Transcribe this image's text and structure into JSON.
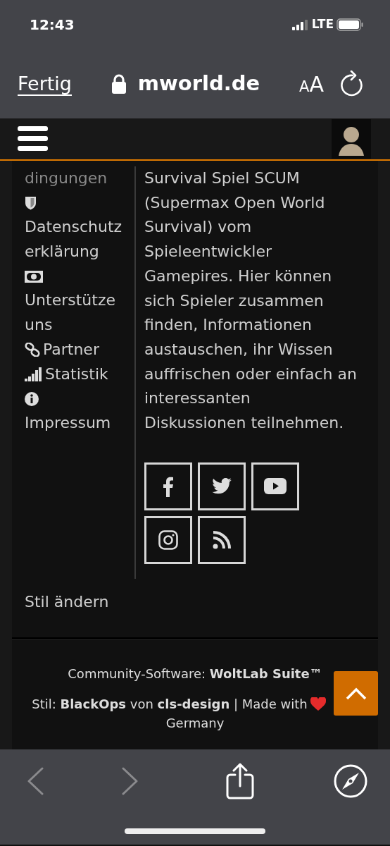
{
  "status_bar": {
    "time": "12:43",
    "network": "LTE"
  },
  "url_bar": {
    "done": "Fertig",
    "address": "mworld.de",
    "text_size": "AA"
  },
  "sidebar": {
    "items": [
      {
        "kind": "plain",
        "lines": [
          "dingungen"
        ]
      },
      {
        "kind": "privacy",
        "lines": [
          "Datenschutz",
          "erklärung"
        ]
      },
      {
        "kind": "support",
        "lines": [
          "Unterstütze",
          "uns"
        ]
      },
      {
        "kind": "partner",
        "lines": [
          "Partner"
        ]
      },
      {
        "kind": "stats",
        "lines": [
          "Statistik"
        ]
      },
      {
        "kind": "imprint",
        "lines": [
          "Impressum"
        ]
      }
    ],
    "style_link": "Stil ändern"
  },
  "about": "Survival Spiel SCUM (Supermax Open World Survival) vom Spieleentwickler Gamepires. Hier können sich Spieler zusammen finden, Informationen austauschen, ihr Wissen auffrischen oder einfach an interessanten Diskussionen teilnehmen.",
  "social": [
    {
      "kind": "facebook"
    },
    {
      "kind": "twitter"
    },
    {
      "kind": "youtube"
    },
    {
      "kind": "instagram"
    },
    {
      "kind": "rss"
    }
  ],
  "footer": {
    "software": "Community-Software: **WoltLab Suite™**",
    "style_credit": "Stil: **BlackOps** von **cls-design** | Made with",
    "country": "Germany"
  },
  "toolbar": {
    "back": {
      "disabled": true
    },
    "forward": {
      "disabled": true
    }
  }
}
